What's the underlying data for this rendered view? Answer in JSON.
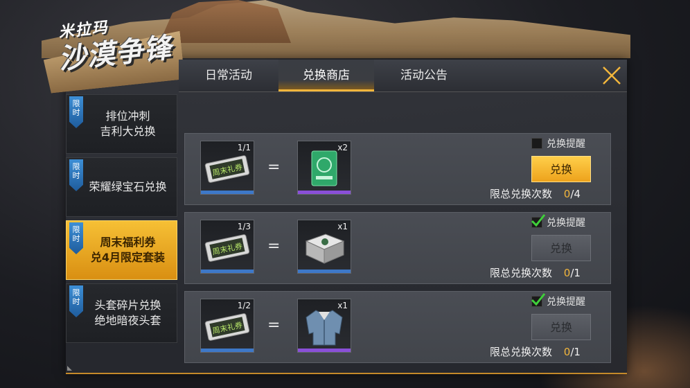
{
  "logo": {
    "line1": "米拉玛",
    "line2": "沙漠争锋"
  },
  "tabs": [
    {
      "label": "日常活动"
    },
    {
      "label": "兑换商店"
    },
    {
      "label": "活动公告"
    }
  ],
  "active_tab": 1,
  "sidebar": {
    "badge": "限\n时",
    "items": [
      {
        "label": "排位冲刺\n吉利大兑换"
      },
      {
        "label": "荣耀绿宝石兑换"
      },
      {
        "label": "周末福利券\n兑4月限定套装"
      },
      {
        "label": "头套碎片兑换\n绝地暗夜头套"
      }
    ],
    "active_index": 2
  },
  "ticket_text": "周末礼券",
  "rows": [
    {
      "cost_count": "1/1",
      "equals": "=",
      "reward_count": "x2",
      "reward_icon": "green-gem-card-icon",
      "reward_rarity_color": "#8a4fd8",
      "remind_label": "兑换提醒",
      "remind_checked": false,
      "button_label": "兑换",
      "button_enabled": true,
      "limit_label": "限总兑换次数",
      "limit_used": "0",
      "limit_total": "/4"
    },
    {
      "cost_count": "1/3",
      "equals": "=",
      "reward_count": "x1",
      "reward_icon": "supply-crate-icon",
      "reward_rarity_color": "#3d78c8",
      "remind_label": "兑换提醒",
      "remind_checked": true,
      "button_label": "兑换",
      "button_enabled": false,
      "limit_label": "限总兑换次数",
      "limit_used": "0",
      "limit_total": "/1"
    },
    {
      "cost_count": "1/2",
      "equals": "=",
      "reward_count": "x1",
      "reward_icon": "denim-jacket-icon",
      "reward_rarity_color": "#8a4fd8",
      "remind_label": "兑换提醒",
      "remind_checked": true,
      "button_label": "兑换",
      "button_enabled": false,
      "limit_label": "限总兑换次数",
      "limit_used": "0",
      "limit_total": "/1"
    }
  ],
  "colors": {
    "accent": "#f2b63c",
    "cost_bar": "#3d78c8",
    "check": "#3fcf3a"
  }
}
